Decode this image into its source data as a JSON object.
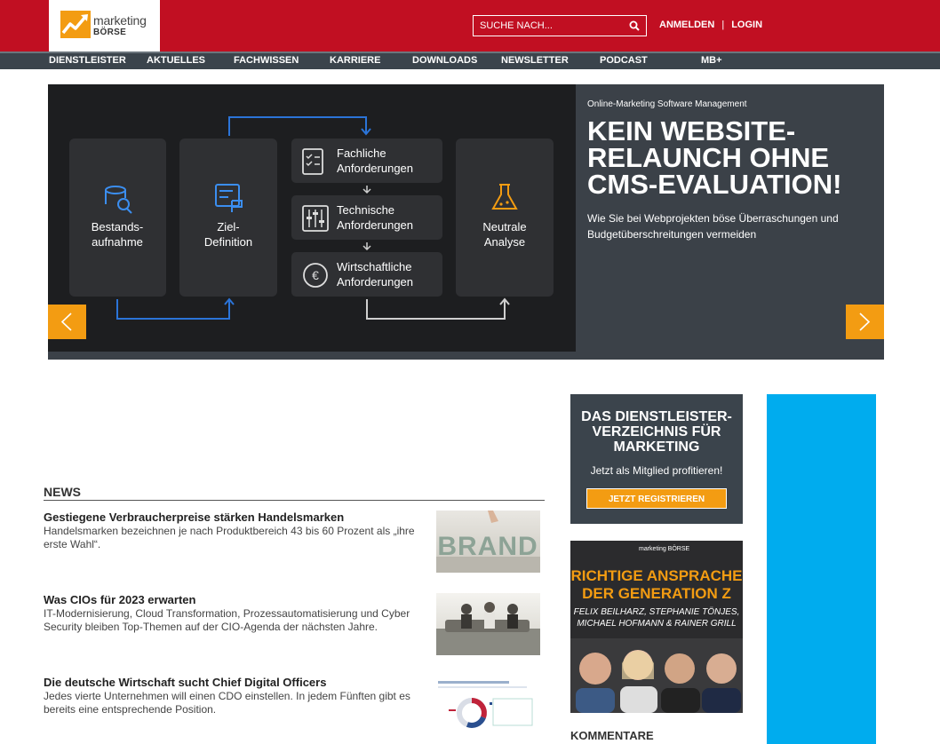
{
  "header": {
    "logo_line1": "marketing",
    "logo_line2": "BÖRSE",
    "search_placeholder": "SUCHE NACH...",
    "register_label": "ANMELDEN",
    "separator": "|",
    "login_label": "LOGIN"
  },
  "nav": {
    "items": [
      "DIENSTLEISTER",
      "AKTUELLES",
      "FACHWISSEN",
      "KARRIERE",
      "DOWNLOADS",
      "NEWSLETTER",
      "PODCAST",
      "MB+"
    ]
  },
  "hero": {
    "kicker": "Online-Marketing Software Management",
    "title": "KEIN WEBSITE-RELAUNCH OHNE CMS-EVALUATION!",
    "subtitle": "Wie Sie bei Webprojekten böse Überraschungen und Budgetüberschreitungen vermeiden",
    "diagram": {
      "box1": [
        "Bestands-",
        "aufnahme"
      ],
      "box2": [
        "Ziel-",
        "Definition"
      ],
      "box3": [
        "Fachliche",
        "Anforderungen"
      ],
      "box4": [
        "Technische",
        "Anforderungen"
      ],
      "box5": [
        "Wirtschaftliche",
        "Anforderungen"
      ],
      "box6": [
        "Neutrale",
        "Analyse"
      ]
    }
  },
  "news": {
    "heading": "NEWS",
    "items": [
      {
        "title": "Gestiegene Verbraucherpreise stärken Handelsmarken",
        "text": "Handelsmarken bezeichnen je nach Produktbereich 43 bis 60 Prozent als „ihre erste Wahl“."
      },
      {
        "title": "Was CIOs für 2023 erwarten",
        "text": "IT-Modernisierung, Cloud Transformation, Prozessautomatisierung und Cyber Security bleiben Top-Themen auf der CIO-Agenda der nächsten Jahre."
      },
      {
        "title": "Die deutsche Wirtschaft sucht Chief Digital Officers",
        "text": "Jedes vierte Unternehmen will einen CDO einstellen. In jedem Fünften gibt es bereits eine entsprechende Position."
      }
    ],
    "thumb1_text": "BRAND"
  },
  "sidebar": {
    "directory_title": "DAS DIENSTLEISTER-VERZEICHNIS FÜR MARKETING",
    "directory_sub": "Jetzt als Mitglied profitieren!",
    "directory_button": "JETZT REGISTRIEREN",
    "book_brand": "marketing BÖRSE",
    "book_title": "RICHTIGE ANSPRACHE DER GENERATION Z",
    "book_authors": "FELIX BEILHARZ, STEPHANIE TÖNJES, MICHAEL HOFMANN & RAINER GRILL",
    "comments_heading": "KOMMENTARE"
  },
  "colors": {
    "brand_red": "#c10f22",
    "accent_orange": "#f39c12",
    "dark_slate": "#3b444c",
    "ad_blue": "#00acee"
  }
}
